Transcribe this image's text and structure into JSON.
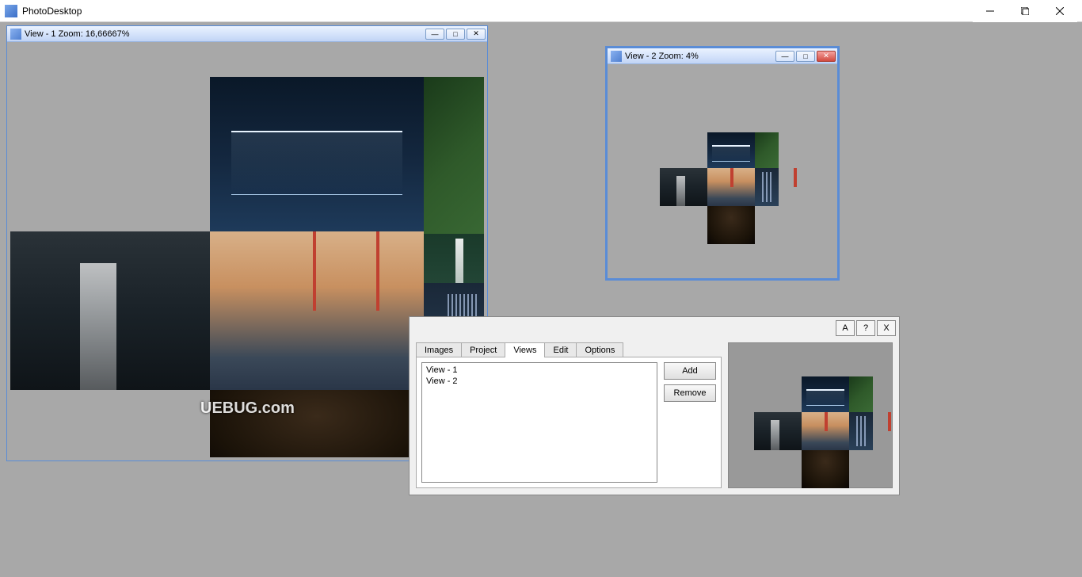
{
  "app": {
    "title": "PhotoDesktop"
  },
  "view1": {
    "title": "View - 1   Zoom: 16,66667%",
    "watermark": "UEBUG.com"
  },
  "view2": {
    "title": "View - 2   Zoom: 4%"
  },
  "dialog": {
    "btns": {
      "a": "A",
      "help": "?",
      "close": "X"
    },
    "tabs": {
      "images": "Images",
      "project": "Project",
      "views": "Views",
      "edit": "Edit",
      "options": "Options"
    },
    "list": [
      "View - 1",
      "View - 2"
    ],
    "add": "Add",
    "remove": "Remove"
  }
}
